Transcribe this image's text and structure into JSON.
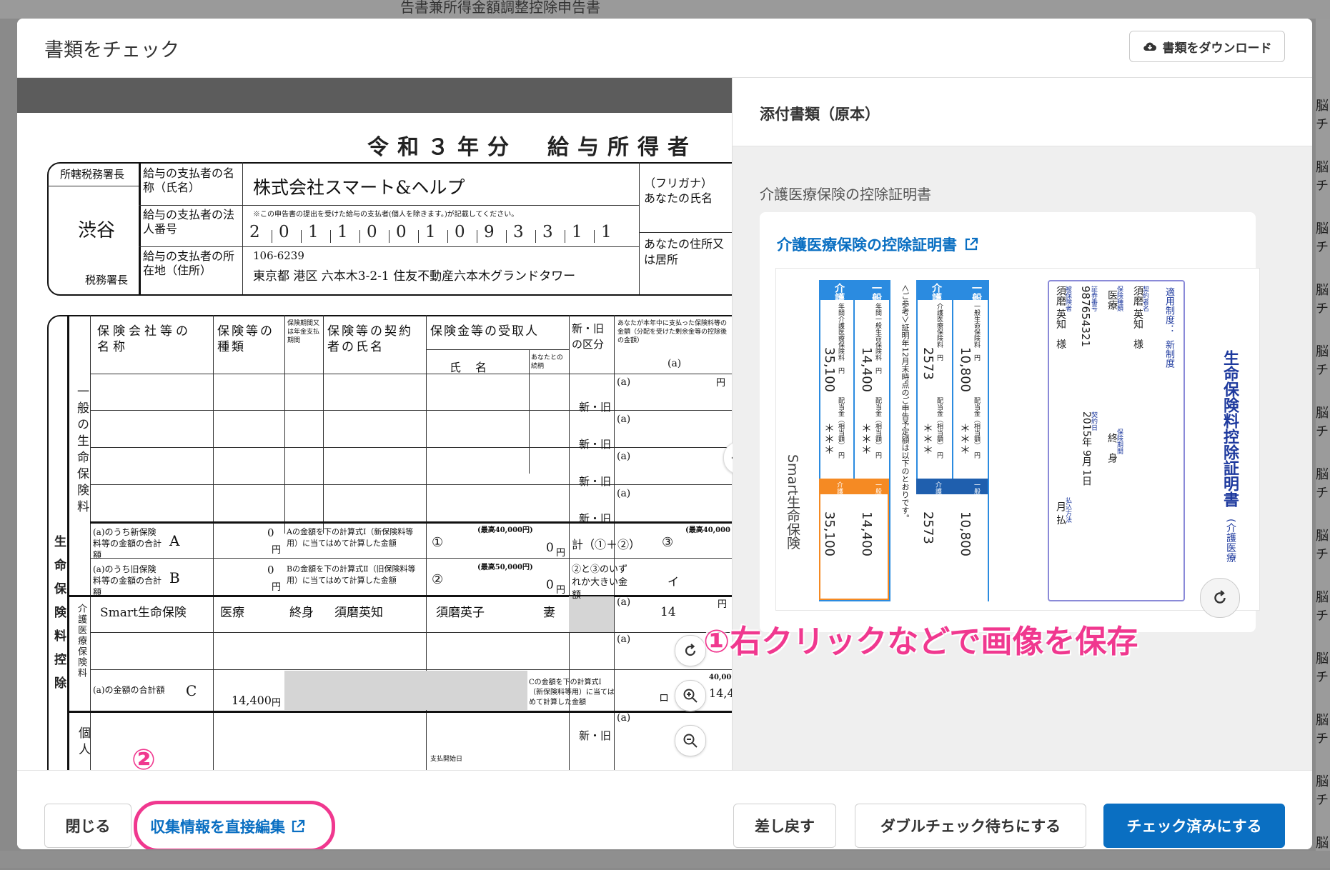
{
  "background": {
    "strip_text": "告書兼所得金額調整控除申告書",
    "right_glyph": "脳チ"
  },
  "modal": {
    "title": "書類をチェック",
    "download_label": "書類をダウンロード"
  },
  "document": {
    "form_title": "令和３年分　給与所得者",
    "tax_office_header": "所轄税務署長",
    "tax_office_name": "渋谷",
    "tax_office_footer": "税務署長",
    "payer_name_label": "給与の支払者の名称（氏名）",
    "payer_name": "株式会社スマート&ヘルプ",
    "payer_number_label": "給与の支払者の法人番号",
    "payer_number_note": "※この申告書の提出を受けた給与の支払者(個人を除きます。)が記載してください。",
    "payer_number_digits": [
      "2",
      "0",
      "1",
      "1",
      "0",
      "0",
      "1",
      "0",
      "9",
      "3",
      "3",
      "1",
      "1"
    ],
    "payer_address_label": "給与の支払者の所在地（住所）",
    "payer_postal": "106-6239",
    "payer_address": "東京都 港区 六本木3-2-1 住友不動産六本木グランドタワー",
    "furigana_label": "（フリガナ）",
    "your_name_label": "あなたの氏名",
    "your_address_label": "あなたの住所又は居所",
    "col_company": "保険会社等の名称",
    "col_type": "保険等の種類",
    "col_period": "保険期間又は年金支払期間",
    "col_contractor": "保険等の契約者の氏名",
    "col_recipient": "保険金等の受取人",
    "col_recipient_name": "氏名",
    "col_relation": "あなたとの続柄",
    "col_new_old": "新・旧の区分",
    "col_amount": "あなたが本年中に支払った保険料等の金額（分配を受けた剰余金等の控除後の金額）",
    "col_amount_a": "(a)",
    "general_label": "一般の生命保険料",
    "life_label": "生命保険料控除",
    "care_label": "介護医療保険料",
    "individual_label": "個人",
    "new_old_text": "新・旧",
    "a_mark": "(a)",
    "yen": "円",
    "new_total_label": "(a)のうち新保険料等の金額の合計額",
    "new_total_letter": "A",
    "new_total_value": "0",
    "new_calc_label": "Aの金額を下の計算式Ⅰ（新保険料等用）に当てはめて計算した金額",
    "new_calc_max": "(最高40,000円)",
    "new_calc_mark": "①",
    "new_calc_value": "0",
    "old_total_label": "(a)のうち旧保険料等の金額の合計額",
    "old_total_letter": "B",
    "old_total_value": "0",
    "old_calc_label": "Bの金額を下の計算式Ⅱ（旧保険料等用）に当てはめて計算した金額",
    "old_calc_max": "(最高50,000円)",
    "old_calc_mark": "②",
    "old_calc_value": "0",
    "sum_label": "計（①＋②）",
    "sum_mark": "③",
    "sum_max": "(最高40,000",
    "larger_label": "②と③のいずれか大きい金額",
    "larger_mark": "イ",
    "care_row": {
      "company": "Smart生命保険",
      "type": "医療",
      "period": "終身",
      "contractor": "須磨英知",
      "recipient": "須磨英子",
      "relation": "妻",
      "amount_partial": "14"
    },
    "care_total_label": "(a)の金額の合計額",
    "care_total_letter": "C",
    "care_total_value": "14,400",
    "care_calc_label": "Cの金額を下の計算式Ⅰ（新保険料等用）に当てはめて計算した金額",
    "care_calc_mark": "ロ",
    "care_calc_max": "40,000",
    "care_calc_partial": "14,4",
    "pay_start": "支払開始日"
  },
  "attachments": {
    "header": "添付書類（原本）",
    "section_label": "介護医療保険の控除証明書",
    "link_label": "介護医療保険の控除証明書",
    "certificate": {
      "title": "生命保険料控除証明書",
      "title_suffix": "(介護医療",
      "system_label": "適用制度：",
      "system_value": "新制度",
      "contractor_label": "契約者名",
      "contractor_value": "須磨 英知　様",
      "insurance_type_label": "保険種類",
      "insurance_type_value": "医療",
      "policy_no_label": "証券番号",
      "policy_no_value": "987654321",
      "insured_label": "被保険者",
      "insured_value": "須磨 英知　様",
      "period_label": "保険期間",
      "period_value": "終　身",
      "contract_date_label": "契約日",
      "contract_date_value": "2015年 9月 1日",
      "payment_label": "払込方法",
      "payment_value": "月 払",
      "general_cert_label": "一般",
      "care_cert_label": "介護",
      "general_premium_label": "一般生命保険料　円",
      "general_premium_value": "10,800",
      "care_premium_label": "介護医療保険料　円",
      "care_premium_value": "2573",
      "dividend_label": "配当金（相当額）　円",
      "dividend_value": "＊＊＊",
      "general_cert_total_label": "一般証明額",
      "care_cert_total_label": "介護医療証明額",
      "reference_note": "＜ご参考＞証明年12月末時点のご申告予定額は以下のとおりです。",
      "annual_general_label": "年間一般生命保険料　円",
      "annual_general_value": "14,400",
      "annual_care_label": "年間介護医療保険料　円",
      "annual_care_value": "35,100",
      "general_declare_label": "一般申告額",
      "care_declare_label": "介護医療申告額",
      "company": "Smart生命保険"
    }
  },
  "annotations": {
    "step1": "①右クリックなどで画像を保存",
    "step2": "②"
  },
  "footer": {
    "close_label": "閉じる",
    "edit_link_label": "収集情報を直接編集",
    "return_label": "差し戻す",
    "double_check_label": "ダブルチェック待ちにする",
    "checked_label": "チェック済みにする"
  },
  "colors": {
    "primary": "#0a6fc2",
    "annotation": "#f0388f",
    "cert_blue": "#2b8be0",
    "cert_orange": "#f58a23",
    "cert_navy": "#1e3a9e"
  }
}
